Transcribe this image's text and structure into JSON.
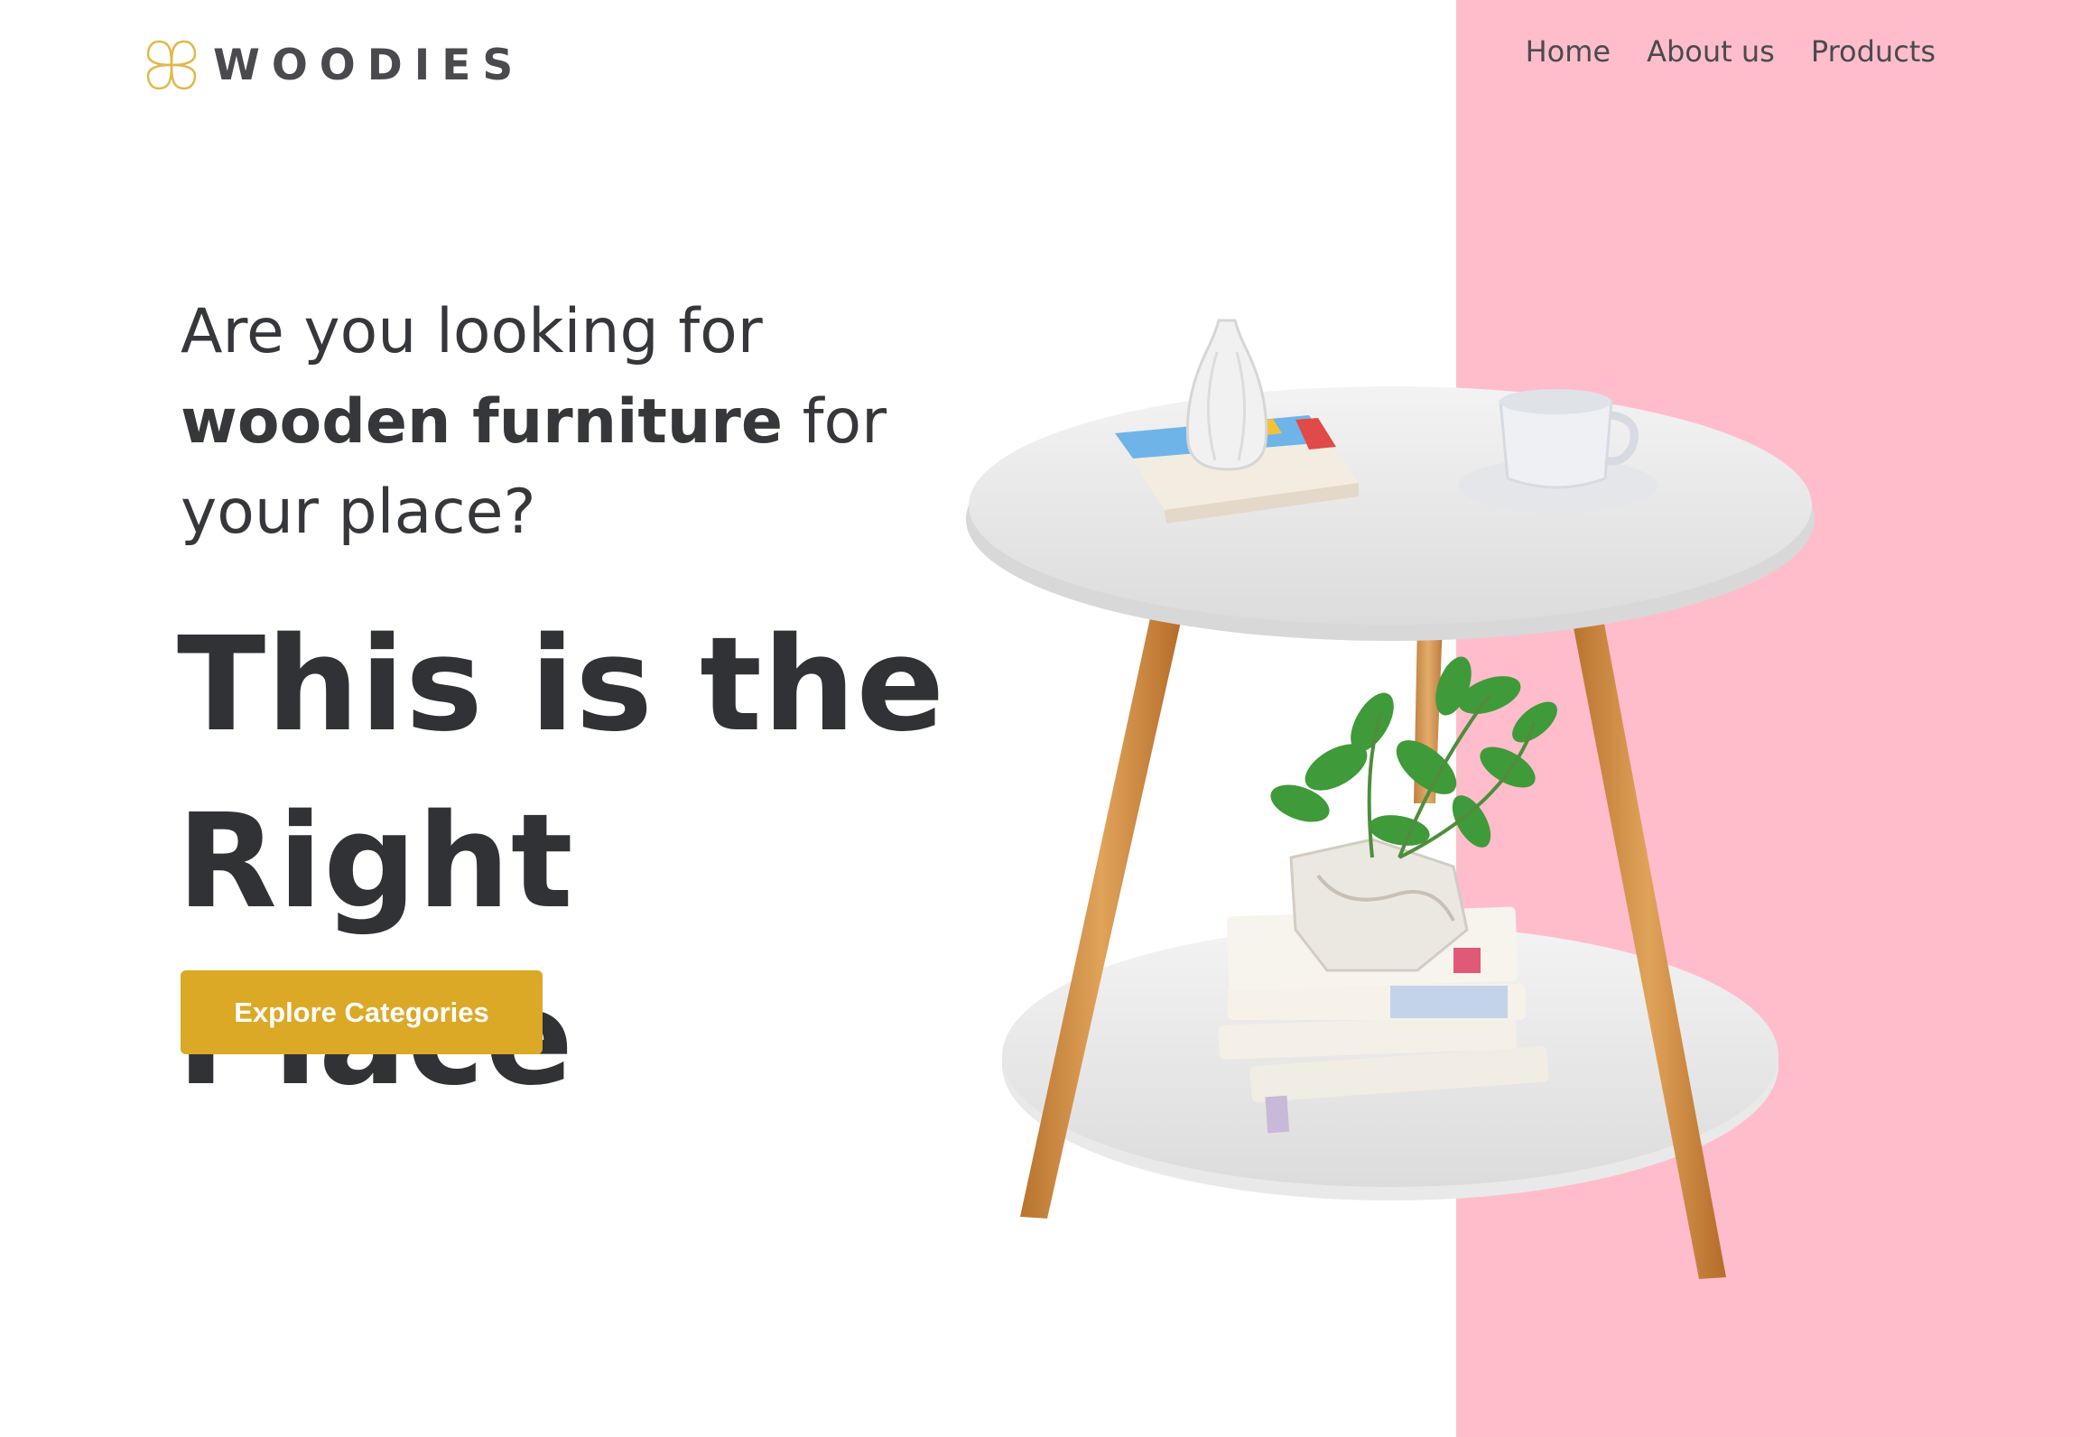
{
  "brand": {
    "name": "WOODIES",
    "logo_icon": "clover-flower-icon",
    "accent": "#dba926"
  },
  "nav": {
    "items": [
      {
        "label": "Home"
      },
      {
        "label": "About us"
      },
      {
        "label": "Products"
      }
    ]
  },
  "hero": {
    "intro_line1": "Are you looking for",
    "intro_bold": "wooden furniture",
    "intro_after_bold": " for",
    "intro_line3": "your place?",
    "headline_line1": "This is the",
    "headline_line2": "Right Place",
    "cta_label": "Explore Categories",
    "image_subject": "side-table-illustration"
  },
  "colors": {
    "panel_pink": "#ffbdcb",
    "text_dark": "#36373b",
    "button": "#dba926"
  }
}
